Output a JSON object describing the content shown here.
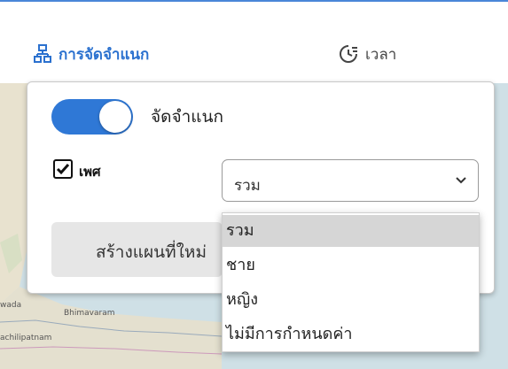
{
  "tabs": {
    "classification_label": "การจัดจำแนก",
    "time_label": "เวลา"
  },
  "toggle": {
    "label": "จัดจำแนก",
    "on": true
  },
  "checkbox": {
    "label": "เพศ",
    "checked": true
  },
  "select": {
    "value": "รวม",
    "options": [
      "รวม",
      "ชาย",
      "หญิง",
      "ไม่มีการกำหนดค่า"
    ],
    "selected_index": 0
  },
  "create_button": {
    "label": "สร้างแผนที่ใหม่"
  },
  "map_labels": {
    "city1": "Bhimavaram",
    "city2": "wada",
    "city3": "achilipatnam"
  },
  "colors": {
    "accent": "#2b71cf",
    "toggle_on": "#2f78d6",
    "map_water": "#cfe0e6"
  }
}
